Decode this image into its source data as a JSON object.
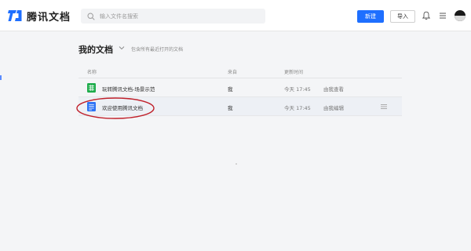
{
  "header": {
    "app_name": "腾讯文档",
    "search_placeholder": "输入文件名搜索",
    "new_button": "新建",
    "import_button": "导入"
  },
  "page": {
    "title": "我的文档",
    "subtitle": "包含所有最近打开的文档"
  },
  "table": {
    "columns": [
      "名称",
      "来自",
      "更新时间"
    ],
    "rows": [
      {
        "name": "玩转腾讯文档-场景示范",
        "from": "我",
        "time": "今天 17:45",
        "permission": "由我查看",
        "icon": "sheet-icon",
        "icon_color": "#1fad4c"
      },
      {
        "name": "欢迎使用腾讯文档",
        "from": "我",
        "time": "今天 17:45",
        "permission": "由我编辑",
        "icon": "doc-icon",
        "icon_color": "#2d73f5"
      }
    ]
  },
  "colors": {
    "accent": "#1e6fff",
    "highlight": "#c0202a"
  }
}
